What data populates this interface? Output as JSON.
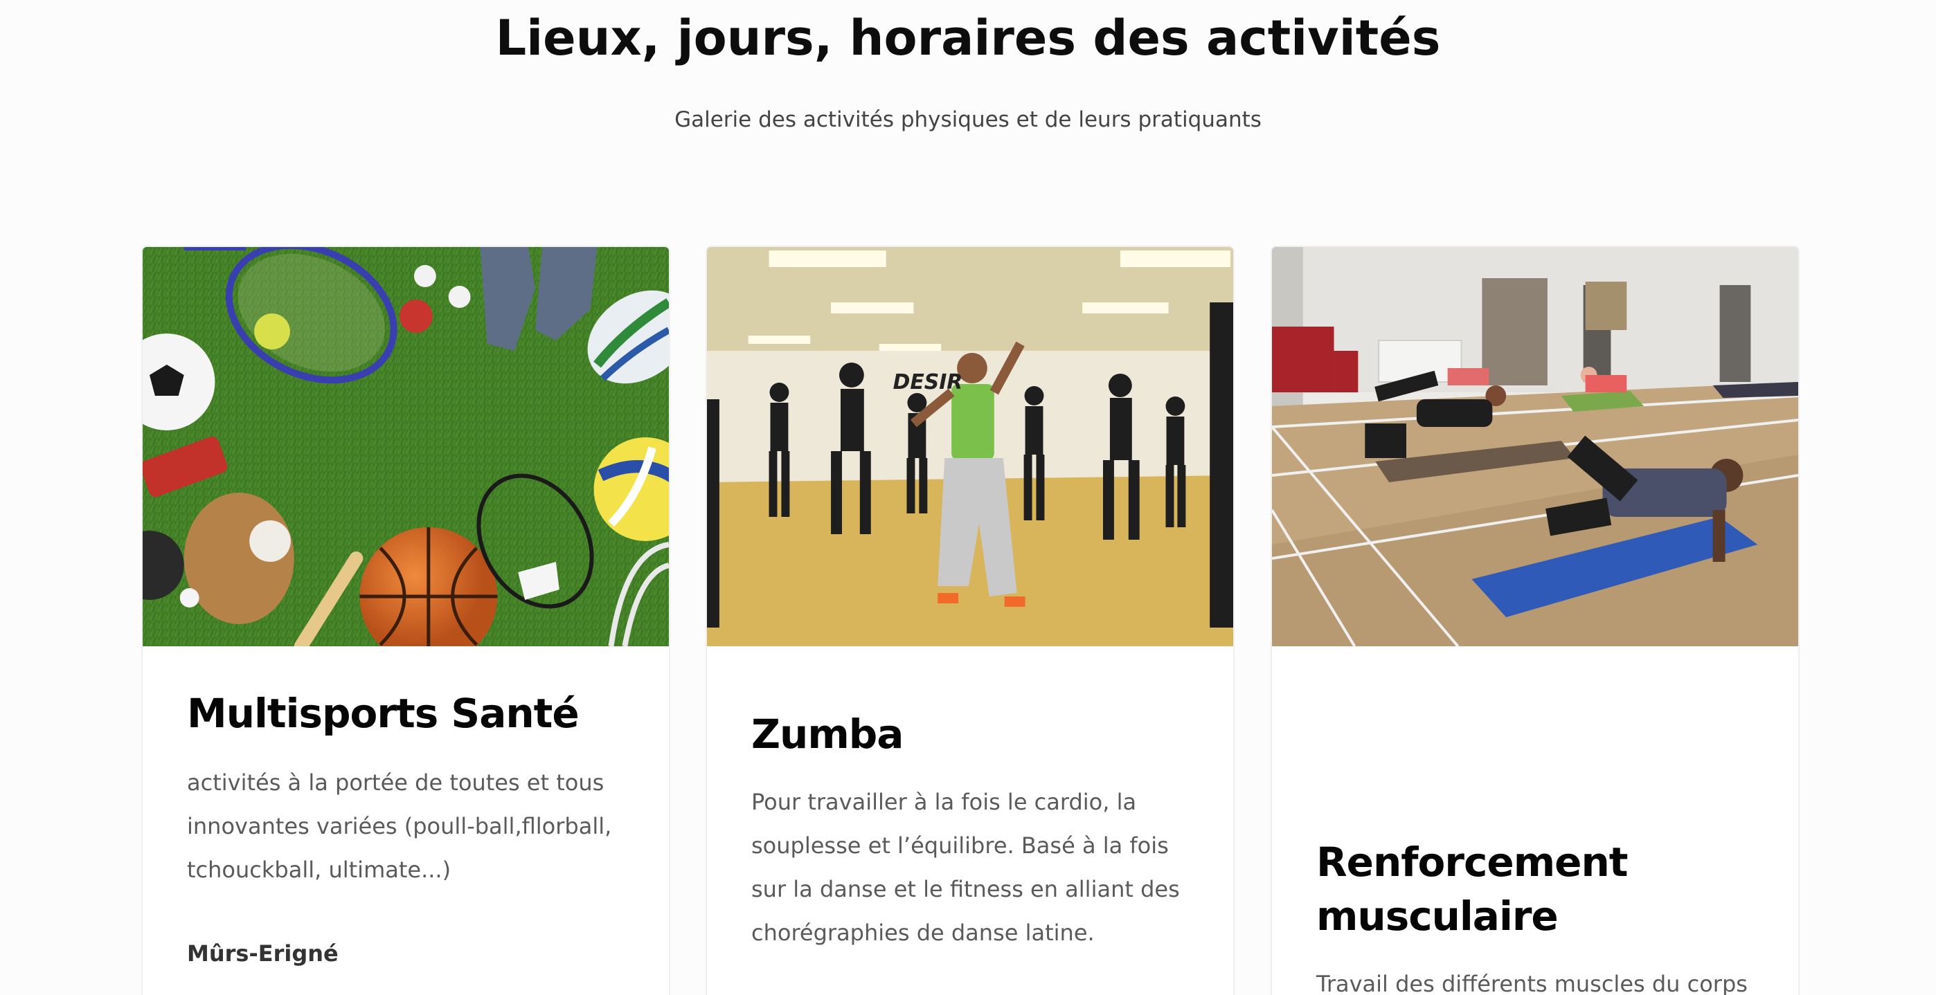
{
  "section": {
    "title": "Lieux, jours, horaires des activités",
    "subtitle": "Galerie des activités physiques et de leurs pratiquants"
  },
  "cards": [
    {
      "title": "Multisports Santé",
      "description": "activités à la portée de toutes et tous innovantes variées (poull-ball,fllorball, tchouckball, ultimate...)",
      "place": "Mûrs-Erigné",
      "image": "sports-equipment-on-grass"
    },
    {
      "title": "Zumba",
      "description": "Pour travailler à la fois le cardio, la souplesse et l’équilibre. Basé à la fois sur la danse et le fitness en alliant des chorégraphies de danse latine.",
      "image": "zumba-dance-class"
    },
    {
      "title": "Renforcement musculaire",
      "description": "Travail des différents muscles du corps",
      "image": "muscle-training-gym"
    }
  ],
  "colors": {
    "background": "#fcfcfc",
    "card_background": "#ffffff",
    "title": "#0d0d0d",
    "text": "#5a5a5a",
    "grass": "#3f7a24",
    "studio_floor": "#d8b45a",
    "gym_floor": "#b89a72"
  }
}
